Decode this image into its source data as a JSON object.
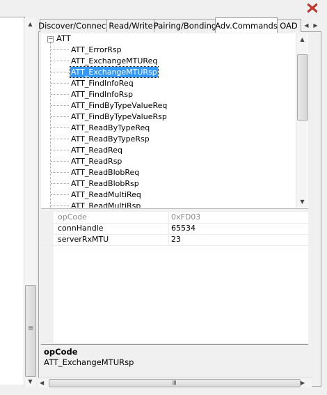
{
  "window": {
    "close_icon": "close-x-icon"
  },
  "tabs": [
    {
      "label": "Discover/Connect"
    },
    {
      "label": "Read/Write"
    },
    {
      "label": "Pairing/Bonding"
    },
    {
      "label": "Adv.Commands"
    },
    {
      "label": "OAD"
    }
  ],
  "active_tab": "Adv.Commands",
  "tree": {
    "root": {
      "toggle": "−",
      "label": "ATT"
    },
    "items": [
      {
        "label": "ATT_ErrorRsp"
      },
      {
        "label": "ATT_ExchangeMTUReq"
      },
      {
        "label": "ATT_ExchangeMTURsp"
      },
      {
        "label": "ATT_FindInfoReq"
      },
      {
        "label": "ATT_FindInfoRsp"
      },
      {
        "label": "ATT_FindByTypeValueReq"
      },
      {
        "label": "ATT_FindByTypeValueRsp"
      },
      {
        "label": "ATT_ReadByTypeReq"
      },
      {
        "label": "ATT_ReadByTypeRsp"
      },
      {
        "label": "ATT_ReadReq"
      },
      {
        "label": "ATT_ReadRsp"
      },
      {
        "label": "ATT_ReadBlobReq"
      },
      {
        "label": "ATT_ReadBlobRsp"
      },
      {
        "label": "ATT_ReadMultiReq"
      },
      {
        "label": "ATT_ReadMultiRsp"
      }
    ],
    "selected": "ATT_ExchangeMTURsp"
  },
  "properties": [
    {
      "name": "opCode",
      "value": "0xFD03",
      "readonly": true
    },
    {
      "name": "connHandle",
      "value": "65534",
      "readonly": false
    },
    {
      "name": "serverRxMTU",
      "value": "23",
      "readonly": false
    }
  ],
  "description": {
    "title": "opCode",
    "text": "ATT_ExchangeMTURsp"
  },
  "scroll_grip": "≡",
  "colors": {
    "selection": "#3399ff",
    "close_icon": "#d93a2b"
  }
}
